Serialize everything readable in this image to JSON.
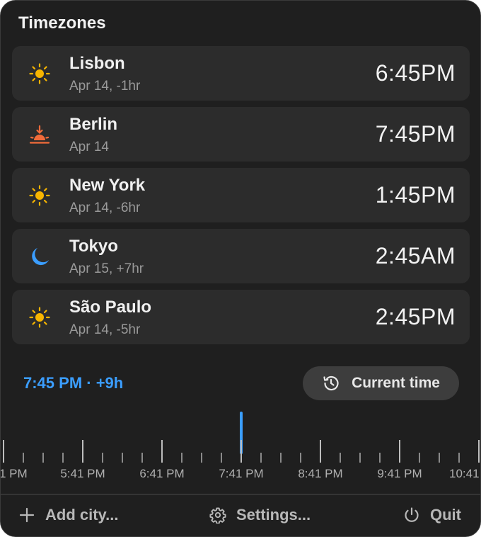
{
  "header": {
    "title": "Timezones"
  },
  "cities": [
    {
      "name": "Lisbon",
      "sub": "Apr 14, -1hr",
      "time": "6:45PM",
      "icon": "sun-icon"
    },
    {
      "name": "Berlin",
      "sub": "Apr 14",
      "time": "7:45PM",
      "icon": "sunset-icon"
    },
    {
      "name": "New York",
      "sub": "Apr 14, -6hr",
      "time": "1:45PM",
      "icon": "sun-icon"
    },
    {
      "name": "Tokyo",
      "sub": "Apr 15, +7hr",
      "time": "2:45AM",
      "icon": "moon-icon"
    },
    {
      "name": "São Paulo",
      "sub": "Apr 14, -5hr",
      "time": "2:45PM",
      "icon": "sun-icon"
    }
  ],
  "scrubber": {
    "readout": "7:45 PM · +9h",
    "current_button_label": "Current time",
    "current_button_icon": "history-icon",
    "labels": [
      "1 PM",
      "5:41 PM",
      "6:41 PM",
      "7:41 PM",
      "8:41 PM",
      "9:41 PM",
      "10:41"
    ]
  },
  "footer": {
    "add_city": "Add city...",
    "settings": "Settings...",
    "quit": "Quit"
  },
  "colors": {
    "accent": "#3b9eff",
    "sun": "#f7b500",
    "sunset": "#f26b3a",
    "moon": "#3b9eff",
    "panel": "#1f1f1f",
    "card": "#2c2c2c"
  }
}
